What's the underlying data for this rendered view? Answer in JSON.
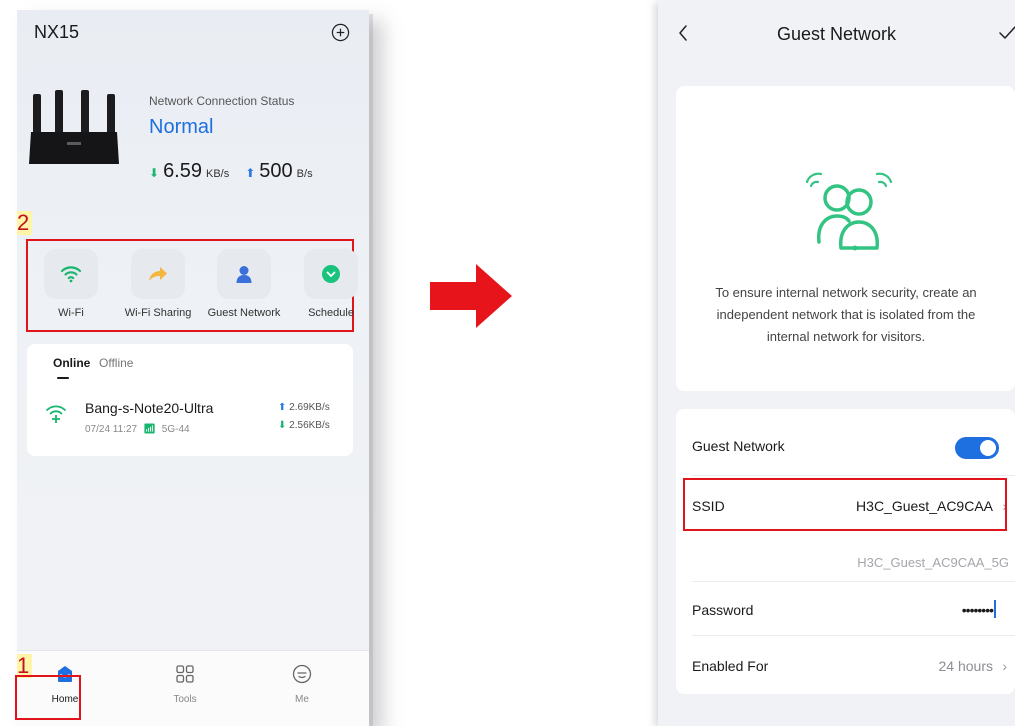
{
  "left_screen": {
    "title": "NX15",
    "status": {
      "label": "Network Connection Status",
      "value": "Normal",
      "download_value": "6.59",
      "download_unit": "KB/s",
      "upload_value": "500",
      "upload_unit": "B/s"
    },
    "quick_actions": [
      {
        "label": "Wi-Fi",
        "icon": "wifi-icon"
      },
      {
        "label": "Wi-Fi Sharing",
        "icon": "share-arrow-icon"
      },
      {
        "label": "Guest Network",
        "icon": "guest-user-icon"
      },
      {
        "label": "Schedule",
        "icon": "schedule-chevron-icon"
      }
    ],
    "devices": {
      "tabs": [
        "Online",
        "Offline"
      ],
      "active_tab": "Online",
      "items": [
        {
          "name": "Bang-s-Note20-Ultra",
          "time": "07/24 11:27",
          "band": "5G-44",
          "upload": "2.69KB/s",
          "download": "2.56KB/s"
        }
      ]
    },
    "nav": [
      {
        "label": "Home",
        "icon": "home-icon",
        "active": true
      },
      {
        "label": "Tools",
        "icon": "tools-grid-icon",
        "active": false
      },
      {
        "label": "Me",
        "icon": "me-face-icon",
        "active": false
      }
    ]
  },
  "annotations": {
    "badge_1": "1",
    "badge_2": "2",
    "highlight_color": "#e0151b"
  },
  "right_screen": {
    "title": "Guest Network",
    "description": "To ensure internal network security, create an independent network that is isolated from the internal network for visitors.",
    "settings": {
      "guest_network_label": "Guest Network",
      "guest_network_enabled": true,
      "ssid_label": "SSID",
      "ssid_value": "H3C_Guest_AC9CAA",
      "ssid_5g_value": "H3C_Guest_AC9CAA_5G",
      "password_label": "Password",
      "password_value": "••••••••",
      "enabled_for_label": "Enabled For",
      "enabled_for_value": "24 hours"
    }
  },
  "colors": {
    "accent_blue": "#1e6fe0",
    "accent_green": "#19b66f",
    "highlight_red": "#e0151b"
  }
}
